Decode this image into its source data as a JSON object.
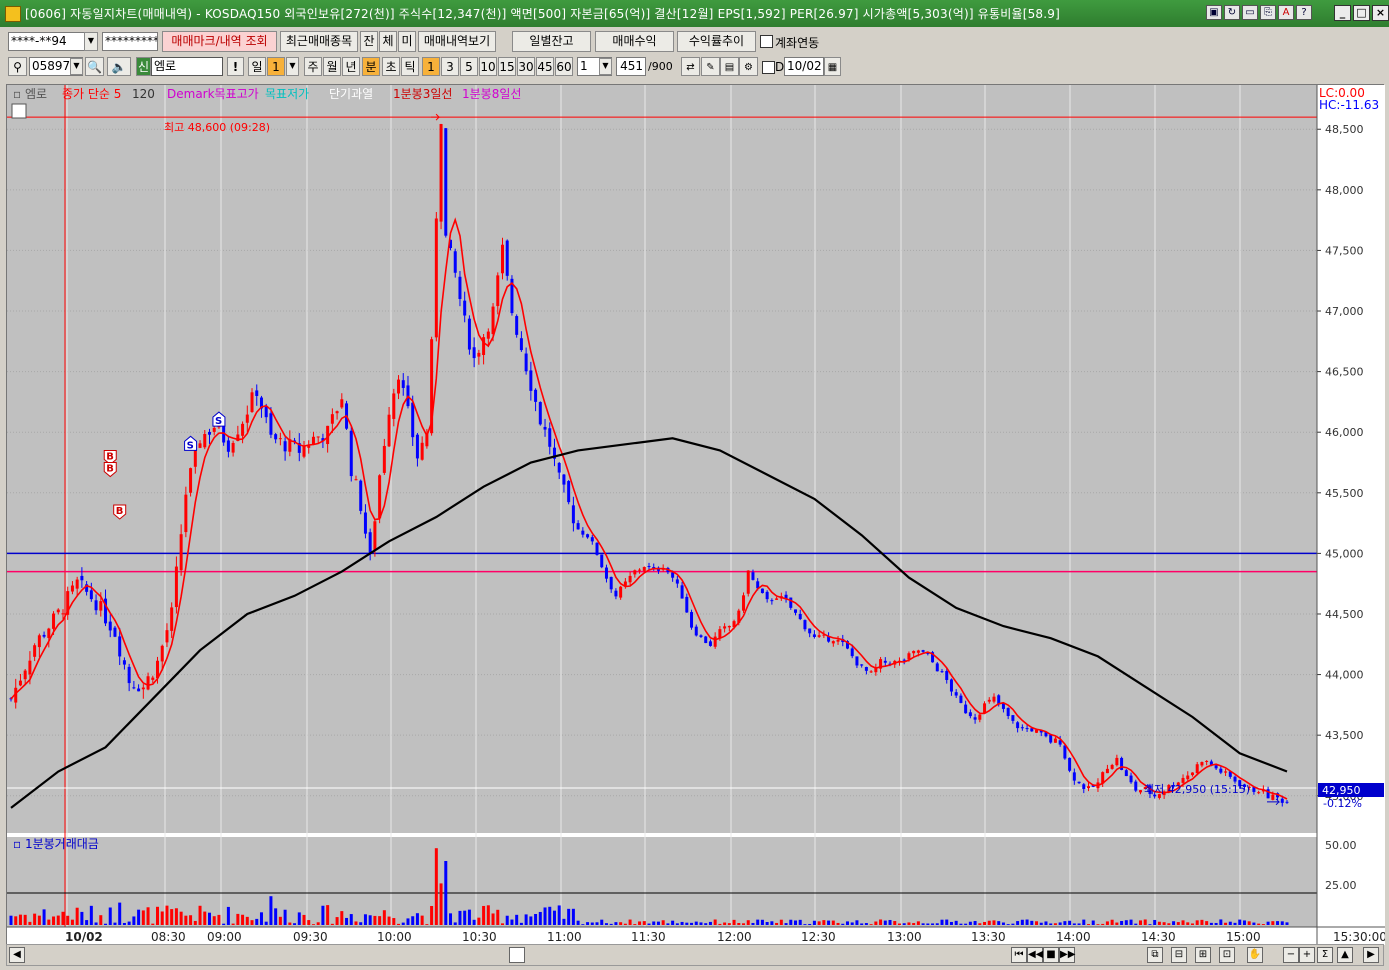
{
  "window": {
    "title": "[0606] 자동일지차트(매매내역) - KOSDAQ150 외국인보유[272(천)] 주식수[12,347(천)] 액면[500] 자본금[65(억)] 결산[12월] EPS[1,592] PER[26.97] 시가총액[5,303(억)] 유통비율[58.9]",
    "title_icons": [
      "window-icon",
      "refresh-icon",
      "screen-icon",
      "link-icon",
      "font-icon",
      "help-icon"
    ],
    "controls": [
      "_",
      "□",
      "X"
    ]
  },
  "toolbar1": {
    "account": "****-**94",
    "password": "*********",
    "trade_mark_button": "매매마크/내역 조회",
    "recent_items_button": "최근매매종목",
    "tab_jan": "잔",
    "tab_che": "체",
    "tab_mi": "미",
    "history_button": "매매내역보기",
    "daily_balance_button": "일별잔고",
    "trade_profit_button": "매매수익",
    "return_trend_button": "수익률추이",
    "account_link_label": "계좌연동"
  },
  "toolbar2": {
    "stock_code": "058970",
    "stock_name": "엠로",
    "new_badge": "신",
    "periods": [
      "일",
      "1",
      "주",
      "월",
      "년",
      "분",
      "초",
      "틱"
    ],
    "active_period": "분",
    "minute_options": [
      "1",
      "3",
      "5",
      "10",
      "15",
      "30",
      "45",
      "60"
    ],
    "active_minute": "1",
    "count_value": "1",
    "data_count": "451",
    "data_total": "/900",
    "date_label": "D",
    "date_value": "10/02"
  },
  "legend": {
    "stock": "엠로",
    "ma_label": "종가 단순 5",
    "ma_value": "120",
    "demark": "Demark목표고가",
    "target": "목표저가",
    "short_overheat": "단기과열",
    "line3": "1분봉3일선",
    "line8": "1분봉8일선",
    "lc": "LC:0.00",
    "hc": "HC:-11.63"
  },
  "annotations": {
    "high": "최고 48,600 (09:28)",
    "low": "최저 42,950 (15:15)",
    "current_price": "42,950",
    "current_change": "-0.12%",
    "buy_mark": "B",
    "sell_mark": "S"
  },
  "volume_panel": {
    "title": "1분봉거래대금",
    "axis": [
      "50.00",
      "25.00"
    ]
  },
  "colors": {
    "up": "#ff0000",
    "down": "#0000ff",
    "ma": "#ff0000",
    "ma120": "#000000",
    "line_blue": "#0000cc",
    "line_magenta": "#ff0066",
    "chart_bg": "#c0c0c0"
  },
  "chart_data": {
    "type": "candlestick",
    "price_axis": [
      "48,500",
      "48,000",
      "47,500",
      "47,000",
      "46,500",
      "46,000",
      "45,500",
      "45,000",
      "44,500",
      "44,000",
      "43,500",
      "43,000"
    ],
    "ylim": [
      42800,
      48700
    ],
    "time_axis": [
      "10/02",
      "08:30",
      "09:00",
      "09:30",
      "10:00",
      "10:30",
      "11:00",
      "11:30",
      "12:00",
      "12:30",
      "13:00",
      "13:30",
      "14:00",
      "14:30",
      "15:00",
      "15:30:00"
    ],
    "high": 48600,
    "low": 42950,
    "h_lines": [
      48600,
      45000,
      44850
    ],
    "price_path": [
      [
        0,
        43800
      ],
      [
        5,
        44250
      ],
      [
        10,
        44500
      ],
      [
        14,
        44750
      ],
      [
        18,
        44600
      ],
      [
        22,
        44350
      ],
      [
        25,
        43950
      ],
      [
        28,
        43900
      ],
      [
        31,
        44100
      ],
      [
        34,
        44500
      ],
      [
        37,
        45500
      ],
      [
        40,
        45950
      ],
      [
        43,
        46050
      ],
      [
        46,
        45900
      ],
      [
        49,
        46100
      ],
      [
        52,
        46350
      ],
      [
        55,
        45950
      ],
      [
        58,
        45900
      ],
      [
        61,
        45850
      ],
      [
        64,
        45950
      ],
      [
        67,
        46000
      ],
      [
        70,
        46300
      ],
      [
        72,
        45700
      ],
      [
        74,
        45400
      ],
      [
        76,
        44950
      ],
      [
        78,
        45650
      ],
      [
        80,
        46200
      ],
      [
        82,
        46500
      ],
      [
        84,
        46150
      ],
      [
        86,
        45800
      ],
      [
        88,
        46000
      ],
      [
        89,
        46700
      ],
      [
        90,
        47800
      ],
      [
        91,
        48600
      ],
      [
        92,
        47600
      ],
      [
        94,
        47300
      ],
      [
        96,
        46900
      ],
      [
        98,
        46600
      ],
      [
        100,
        46800
      ],
      [
        102,
        47000
      ],
      [
        104,
        47500
      ],
      [
        106,
        47000
      ],
      [
        108,
        46700
      ],
      [
        110,
        46400
      ],
      [
        112,
        46100
      ],
      [
        114,
        45900
      ],
      [
        116,
        45600
      ],
      [
        118,
        45400
      ],
      [
        120,
        45200
      ],
      [
        122,
        45150
      ],
      [
        124,
        45000
      ],
      [
        126,
        44800
      ],
      [
        128,
        44650
      ],
      [
        130,
        44750
      ],
      [
        132,
        44850
      ],
      [
        134,
        44900
      ],
      [
        136,
        44850
      ],
      [
        138,
        44900
      ],
      [
        140,
        44800
      ],
      [
        142,
        44650
      ],
      [
        144,
        44400
      ],
      [
        146,
        44300
      ],
      [
        148,
        44250
      ],
      [
        150,
        44350
      ],
      [
        152,
        44400
      ],
      [
        154,
        44500
      ],
      [
        156,
        44850
      ],
      [
        158,
        44700
      ],
      [
        160,
        44600
      ],
      [
        162,
        44650
      ],
      [
        164,
        44600
      ],
      [
        166,
        44500
      ],
      [
        168,
        44400
      ],
      [
        170,
        44300
      ],
      [
        172,
        44300
      ],
      [
        174,
        44300
      ],
      [
        176,
        44250
      ],
      [
        178,
        44150
      ],
      [
        180,
        44050
      ],
      [
        182,
        44000
      ],
      [
        184,
        44100
      ],
      [
        186,
        44100
      ],
      [
        188,
        44100
      ],
      [
        190,
        44150
      ],
      [
        192,
        44200
      ],
      [
        194,
        44150
      ],
      [
        196,
        44050
      ],
      [
        198,
        43950
      ],
      [
        200,
        43800
      ],
      [
        202,
        43700
      ],
      [
        204,
        43650
      ],
      [
        206,
        43750
      ],
      [
        208,
        43800
      ],
      [
        210,
        43700
      ],
      [
        212,
        43600
      ],
      [
        214,
        43550
      ],
      [
        216,
        43550
      ],
      [
        218,
        43500
      ],
      [
        220,
        43450
      ],
      [
        222,
        43450
      ],
      [
        224,
        43200
      ],
      [
        226,
        43100
      ],
      [
        228,
        43050
      ],
      [
        230,
        43100
      ],
      [
        232,
        43250
      ],
      [
        234,
        43300
      ],
      [
        236,
        43150
      ],
      [
        238,
        43050
      ],
      [
        240,
        43050
      ],
      [
        242,
        43000
      ],
      [
        244,
        43050
      ],
      [
        246,
        43100
      ],
      [
        248,
        43150
      ],
      [
        250,
        43200
      ],
      [
        252,
        43300
      ],
      [
        254,
        43250
      ],
      [
        256,
        43200
      ],
      [
        258,
        43150
      ],
      [
        260,
        43100
      ],
      [
        262,
        43050
      ],
      [
        264,
        43050
      ],
      [
        266,
        43000
      ],
      [
        268,
        42980
      ],
      [
        270,
        42950
      ]
    ],
    "ma120_path": [
      [
        0,
        42900
      ],
      [
        10,
        43200
      ],
      [
        20,
        43400
      ],
      [
        30,
        43800
      ],
      [
        40,
        44200
      ],
      [
        50,
        44500
      ],
      [
        60,
        44650
      ],
      [
        70,
        44850
      ],
      [
        80,
        45100
      ],
      [
        90,
        45300
      ],
      [
        100,
        45550
      ],
      [
        110,
        45750
      ],
      [
        120,
        45850
      ],
      [
        130,
        45900
      ],
      [
        140,
        45950
      ],
      [
        150,
        45850
      ],
      [
        160,
        45650
      ],
      [
        170,
        45450
      ],
      [
        180,
        45150
      ],
      [
        190,
        44800
      ],
      [
        200,
        44550
      ],
      [
        210,
        44400
      ],
      [
        220,
        44300
      ],
      [
        230,
        44150
      ],
      [
        240,
        43900
      ],
      [
        250,
        43650
      ],
      [
        260,
        43350
      ],
      [
        270,
        43200
      ]
    ],
    "volume_max": 50
  }
}
